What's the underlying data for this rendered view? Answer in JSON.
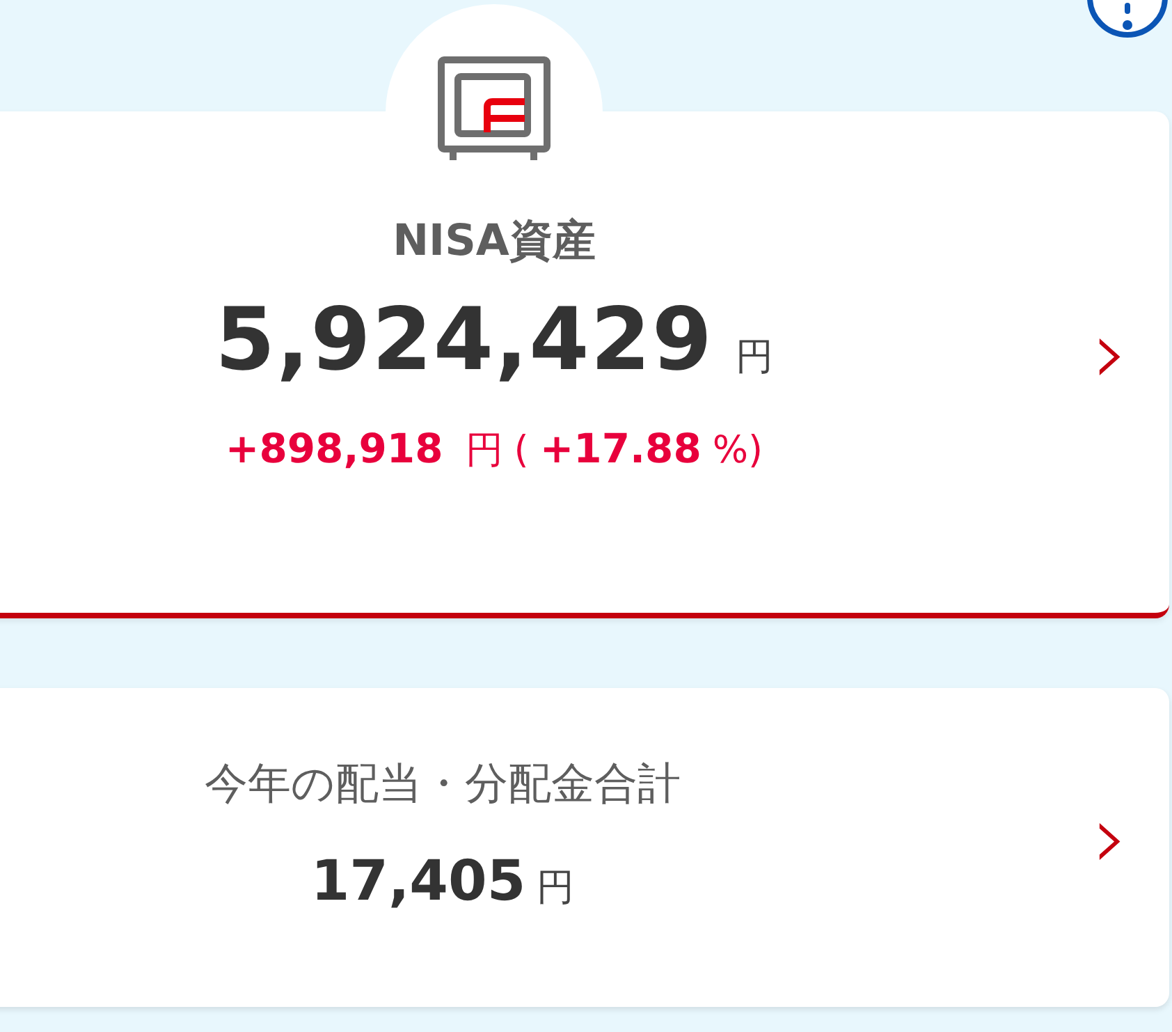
{
  "nisa_card": {
    "title": "NISA資産",
    "amount": "5,924,429",
    "amount_unit": "円",
    "gain": "+898,918",
    "gain_unit": "円",
    "open_paren": "(",
    "gain_percent": "+17.88",
    "percent_unit": "%",
    "close_paren": ")",
    "chevron": "›"
  },
  "dividend_card": {
    "title": "今年の配当・分配金合計",
    "amount": "17,405",
    "amount_unit": "円",
    "chevron": "›"
  }
}
